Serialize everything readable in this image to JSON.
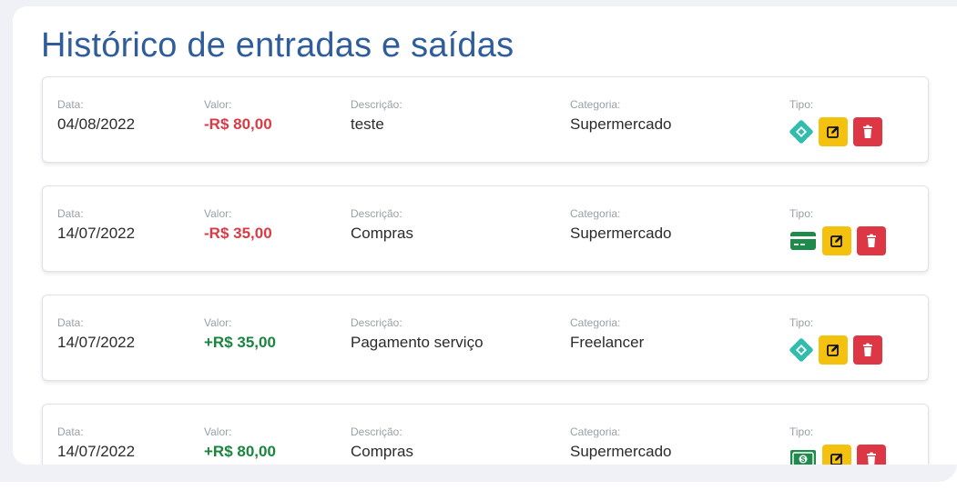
{
  "title": "Histórico de entradas e saídas",
  "labels": {
    "date": "Data:",
    "value": "Valor:",
    "description": "Descrição:",
    "category": "Categoria:",
    "type": "Tipo:"
  },
  "transactions": [
    {
      "date": "04/08/2022",
      "value": "-R$ 80,00",
      "description": "teste",
      "category": "Supermercado",
      "type_icon": "pix-icon",
      "direction": "out"
    },
    {
      "date": "14/07/2022",
      "value": "-R$ 35,00",
      "description": "Compras",
      "category": "Supermercado",
      "type_icon": "card-icon",
      "direction": "out"
    },
    {
      "date": "14/07/2022",
      "value": "+R$ 35,00",
      "description": "Pagamento serviço",
      "category": "Freelancer",
      "type_icon": "pix-icon",
      "direction": "in"
    },
    {
      "date": "14/07/2022",
      "value": "+R$ 80,00",
      "description": "Compras",
      "category": "Supermercado",
      "type_icon": "cash-icon",
      "direction": "in"
    }
  ],
  "actions": {
    "edit_icon": "edit-icon",
    "delete_icon": "trash-icon"
  },
  "colors": {
    "title": "#2f5d9b",
    "negative": "#d93a45",
    "positive": "#19853d",
    "edit": "#f5c10f",
    "delete": "#dd3645",
    "pix": "#32bcad",
    "card_cash": "#1e8a4c"
  }
}
